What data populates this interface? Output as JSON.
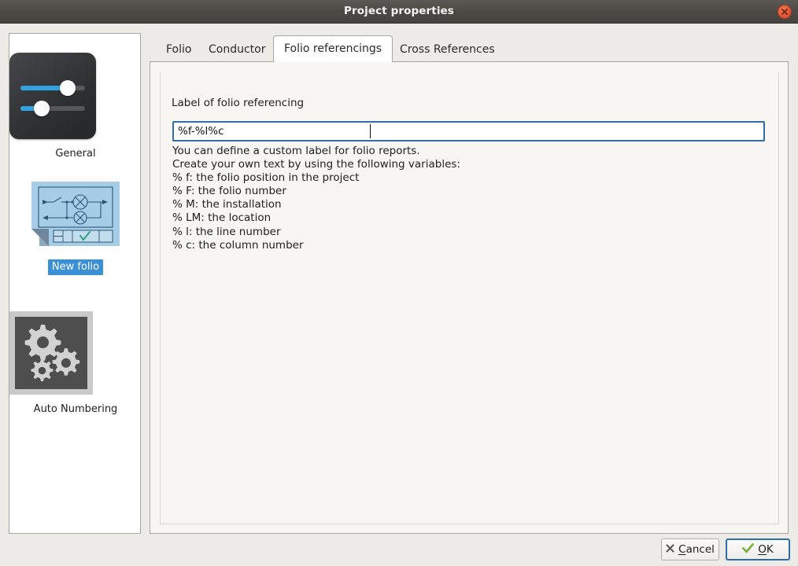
{
  "window": {
    "title": "Project properties",
    "close_icon": "close-icon"
  },
  "sidebar": {
    "items": [
      {
        "label": "General",
        "icon": "sliders-icon",
        "selected": false
      },
      {
        "label": "New folio",
        "icon": "folio-sheet-icon",
        "selected": true
      },
      {
        "label": "Auto Numbering",
        "icon": "gears-icon",
        "selected": false
      }
    ]
  },
  "tabs": [
    {
      "label": "Folio",
      "active": false
    },
    {
      "label": "Conductor",
      "active": false
    },
    {
      "label": "Folio referencings",
      "active": true
    },
    {
      "label": "Cross References",
      "active": false
    }
  ],
  "form": {
    "field_label": "Label of folio referencing",
    "input_value": "%f-%l%c",
    "input_placeholder": "",
    "help_lines": [
      "You can define a custom label for folio reports.",
      "Create your own text by using the following variables:",
      "% f: the folio position in the project",
      "% F: the folio number",
      "% M: the installation",
      "% LM: the location",
      "% l: the line number",
      "% c: the column number"
    ]
  },
  "footer": {
    "cancel_label": "Cancel",
    "cancel_icon": "x-mark-icon",
    "ok_label": "OK",
    "ok_icon": "check-mark-icon"
  },
  "colors": {
    "titlebar": "#4c4945",
    "close_button": "#e2593a",
    "selection": "#3b8fd4",
    "focus_border": "#2f6fa8",
    "panel_bg": "#f8f6f3",
    "window_bg": "#ecebe7",
    "accent_blue": "#32a3e0",
    "check_green": "#7cb342"
  }
}
